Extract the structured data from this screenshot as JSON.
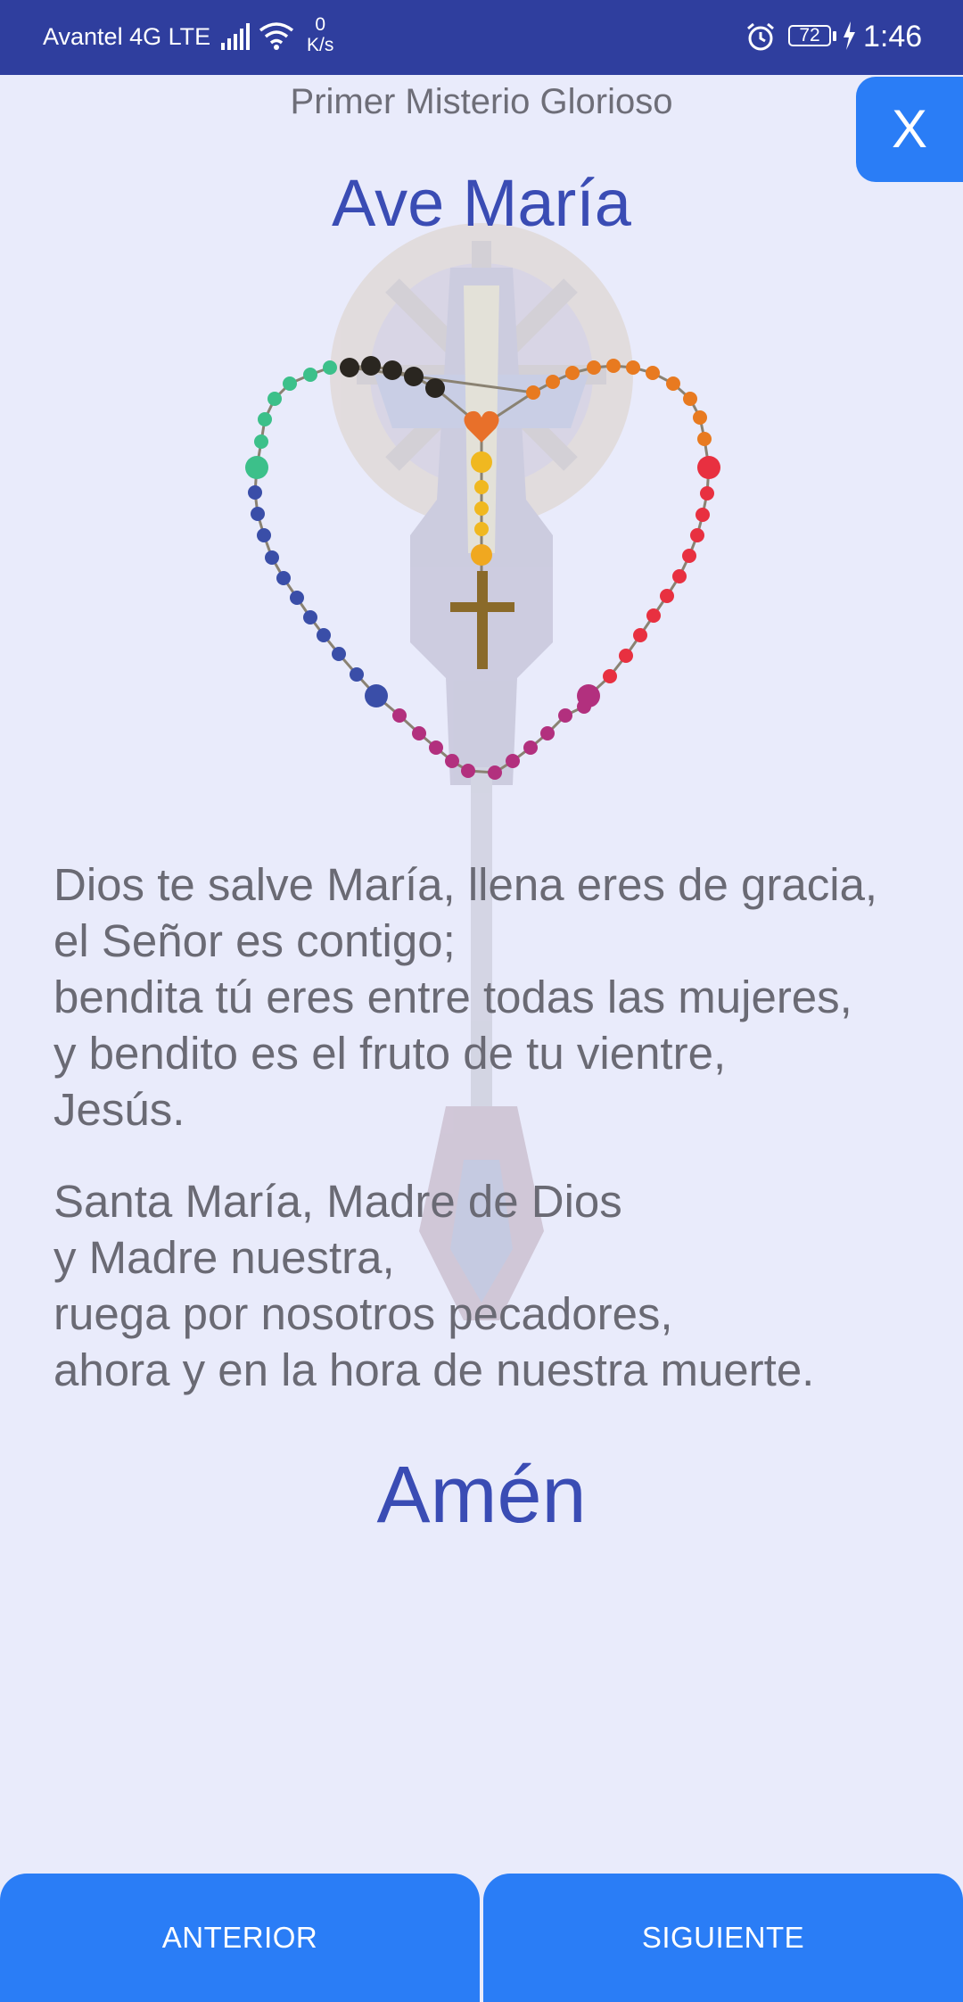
{
  "status_bar": {
    "carrier": "Avantel 4G LTE",
    "speed_value": "0",
    "speed_unit": "K/s",
    "battery": "72",
    "time": "1:46"
  },
  "header": {
    "subtitle": "Primer Misterio Glorioso",
    "title": "Ave María",
    "close_label": "X"
  },
  "prayer": {
    "paragraph1": "Dios te salve María, llena eres de gracia,\nel Señor es contigo;\nbendita tú eres entre todas las mujeres,\ny bendito es el fruto de tu vientre,\nJesús.",
    "paragraph2": "Santa María, Madre de Dios\ny Madre nuestra,\nruega por nosotros pecadores,\nahora y en la hora de nuestra muerte.",
    "closing": "Amén"
  },
  "navigation": {
    "previous_label": "ANTERIOR",
    "next_label": "SIGUIENTE"
  },
  "colors": {
    "status_bar": "#2f3e9e",
    "background": "#e9ebfb",
    "accent": "#2a7df6",
    "title": "#3a4cb4"
  }
}
